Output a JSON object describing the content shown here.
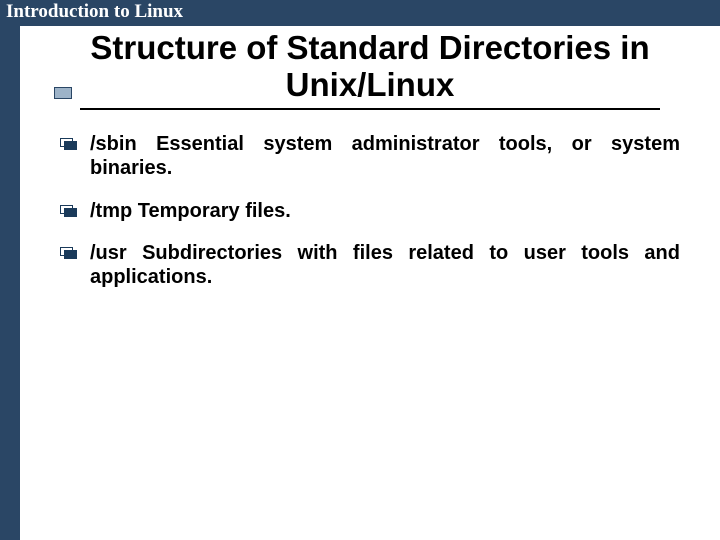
{
  "header": {
    "course": "Introduction to Linux"
  },
  "title": "Structure of Standard Directories in Unix/Linux",
  "bullets": [
    {
      "text": "/sbin Essential system administrator tools, or system binaries."
    },
    {
      "text": "/tmp Temporary files."
    },
    {
      "text": "/usr Subdirectories with files related to user tools and applications."
    }
  ]
}
